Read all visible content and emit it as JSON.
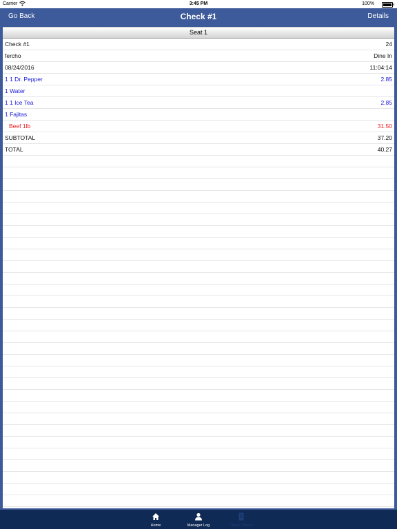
{
  "status_bar": {
    "carrier": "Carrier",
    "time": "3:45 PM",
    "battery": "100%"
  },
  "nav": {
    "back_label": "Go Back",
    "title": "Check #1",
    "details_label": "Details"
  },
  "seat_header": "Seat 1",
  "rows": [
    {
      "left": "Check #1",
      "right": "24",
      "color": "black"
    },
    {
      "left": "fercho",
      "right": "Dine In",
      "color": "black"
    },
    {
      "left": "08/24/2016",
      "right": "11:04:14",
      "color": "black"
    },
    {
      "left": "1 1 Dr. Pepper",
      "right": "2.85",
      "color": "blue"
    },
    {
      "left": "1 Water",
      "right": "",
      "color": "blue"
    },
    {
      "left": "1 1 Ice Tea",
      "right": "2.85",
      "color": "blue"
    },
    {
      "left": "1 Fajitas",
      "right": "",
      "color": "blue"
    },
    {
      "left": "Beef 1lb",
      "right": "31.50",
      "color": "red"
    },
    {
      "left": "SUBTOTAL",
      "right": "37.20",
      "color": "black"
    },
    {
      "left": "TOTAL",
      "right": "40.27",
      "color": "black"
    }
  ],
  "tabs": [
    {
      "label": "Home",
      "icon": "home-icon",
      "active": true
    },
    {
      "label": "Manager Log",
      "icon": "person-icon",
      "active": true
    },
    {
      "label": "Check Viewer",
      "icon": "check-document-icon",
      "active": false
    }
  ],
  "colors": {
    "nav_background": "#3d5a9a",
    "tab_bar_background": "#0f2a55",
    "item_blue": "#1a1ad6",
    "modifier_red": "#e61e1e"
  }
}
